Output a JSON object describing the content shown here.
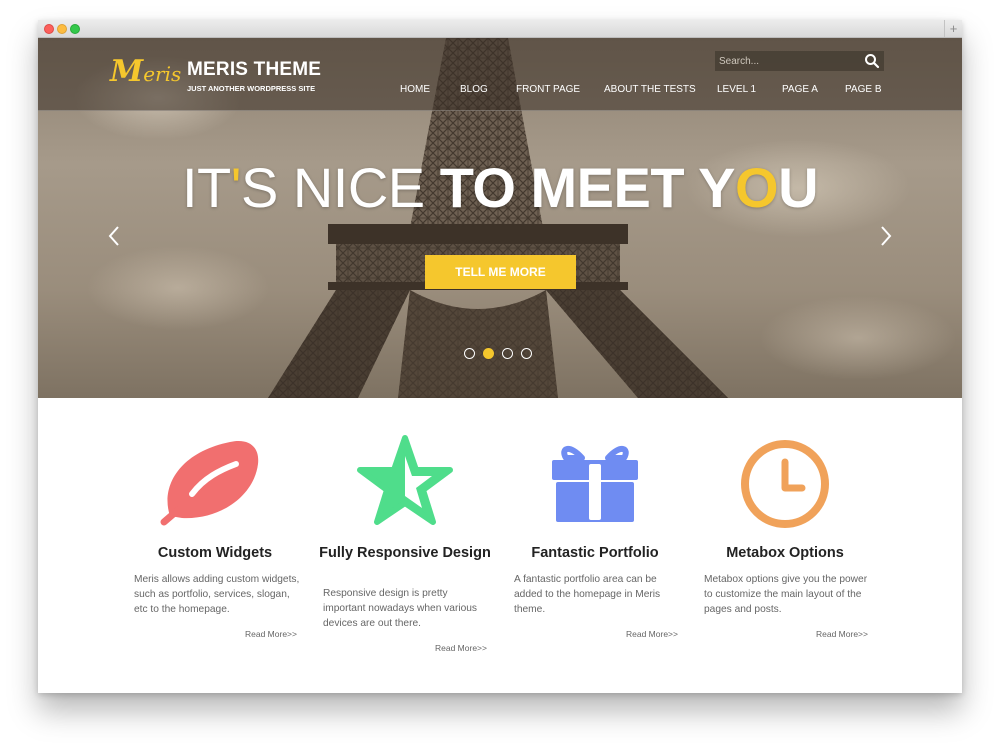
{
  "browser": {
    "new_tab": "+"
  },
  "site": {
    "logo_initial": "M",
    "logo_rest": "eris",
    "title": "MERIS THEME",
    "tagline": "JUST ANOTHER WORDPRESS SITE"
  },
  "search": {
    "placeholder": "Search..."
  },
  "nav": [
    "HOME",
    "BLOG",
    "FRONT PAGE",
    "ABOUT THE TESTS",
    "LEVEL 1",
    "PAGE A",
    "PAGE B"
  ],
  "slider": {
    "headline_part1": "IT",
    "headline_apos": "'",
    "headline_part2": "S NICE ",
    "headline_bold1": "TO MEET Y",
    "headline_bold_yellow": "O",
    "headline_bold2": "U",
    "cta_label": "TELL ME MORE",
    "slide_count": 4,
    "active_slide": 2
  },
  "features": [
    {
      "icon": "leaf-icon",
      "title": "Custom Widgets",
      "text": "Meris allows adding custom widgets, such as portfolio, services, slogan, etc to the homepage.",
      "link": "Read More>>"
    },
    {
      "icon": "star-icon",
      "title": "Fully Responsive Design",
      "text": "Responsive design is pretty important nowadays when various devices are out there.",
      "link": "Read More>>"
    },
    {
      "icon": "gift-icon",
      "title": "Fantastic Portfolio",
      "text": "A fantastic portfolio area can be added to the homepage in Meris theme.",
      "link": "Read More>>"
    },
    {
      "icon": "clock-icon",
      "title": "Metabox Options",
      "text": "Metabox options give you the power to customize the main layout of the pages and posts.",
      "link": "Read More>>"
    }
  ],
  "colors": {
    "accent": "#f5c72d",
    "leaf": "#f16f6f",
    "star": "#4fdd8b",
    "gift": "#6f8cf2",
    "clock": "#f0a25a"
  }
}
